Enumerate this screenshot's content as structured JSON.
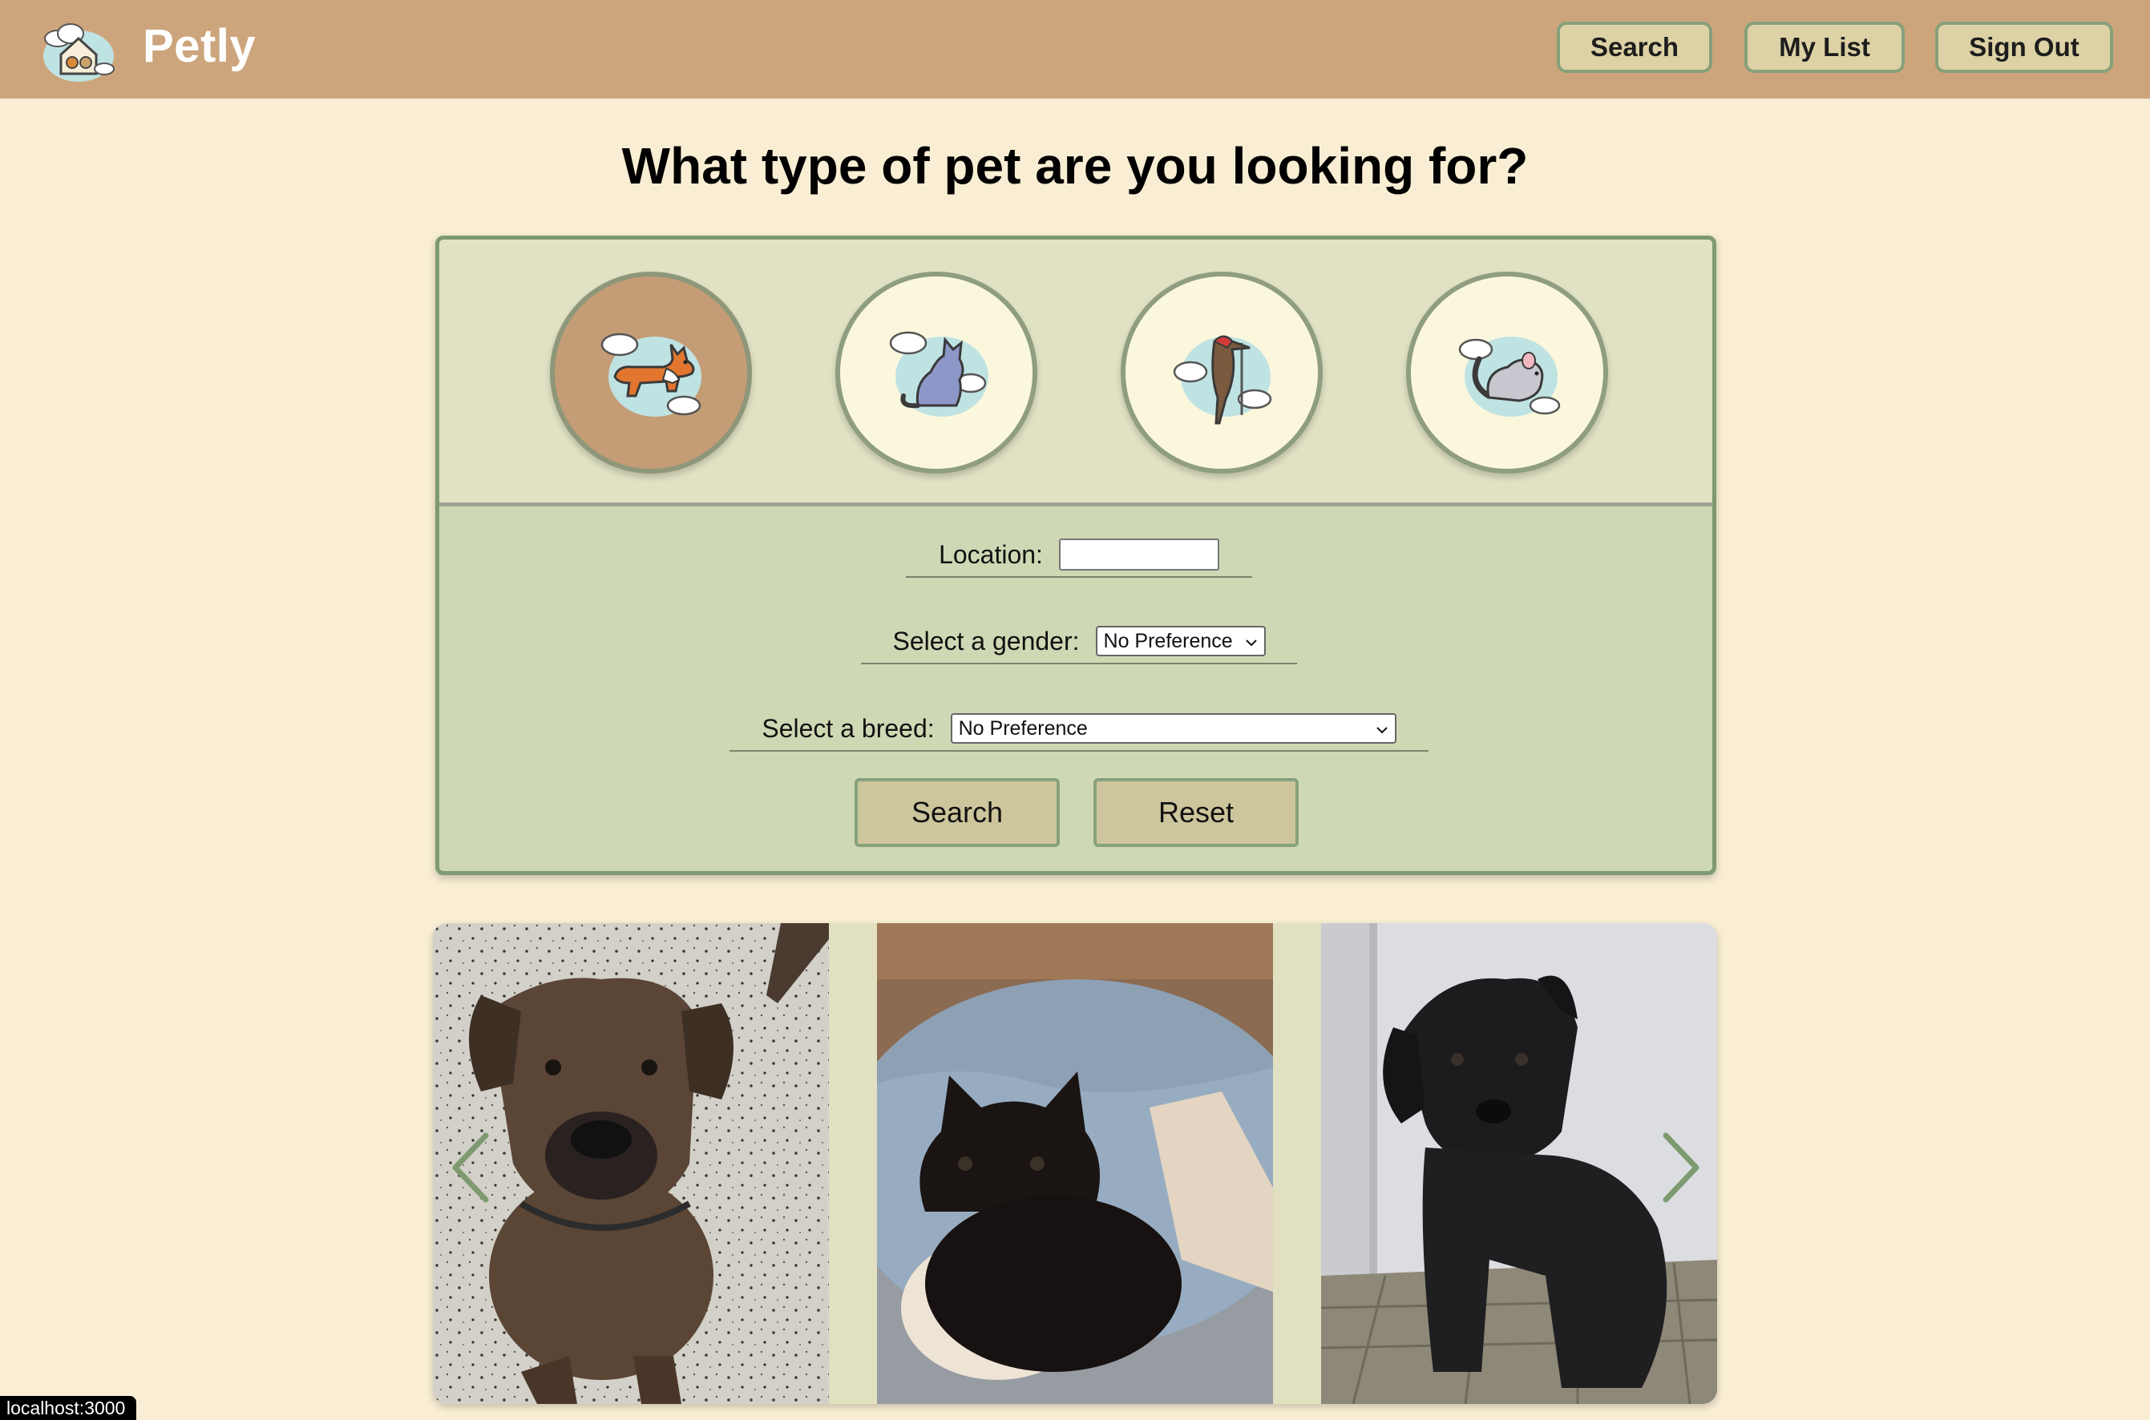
{
  "navbar": {
    "brand": "Petly",
    "buttons": {
      "search": "Search",
      "my_list": "My List",
      "sign_out": "Sign Out"
    }
  },
  "headline": "What type of pet are you looking for?",
  "pet_types": [
    {
      "icon": "dog-icon",
      "selected": true
    },
    {
      "icon": "cat-icon",
      "selected": false
    },
    {
      "icon": "bird-icon",
      "selected": false
    },
    {
      "icon": "small-animal-icon",
      "selected": false
    }
  ],
  "form": {
    "location_label": "Location:",
    "location_value": "",
    "gender_label": "Select a gender:",
    "gender_value": "No Preference",
    "breed_label": "Select a breed:",
    "breed_value": "No Preference",
    "search_button": "Search",
    "reset_button": "Reset"
  },
  "carousel": {
    "photos": [
      "brindle-puppy-photo",
      "black-kitten-photo",
      "black-puppy-photo"
    ],
    "prev_icon": "chevron-left-icon",
    "next_icon": "chevron-right-icon"
  },
  "status_bar": "localhost:3000",
  "colors": {
    "navbar": "#cda57c",
    "page_background": "#f9eed4",
    "panel_top": "#e1e2c3",
    "panel_form": "#cfd8b4",
    "accent_border": "#7d9a70",
    "button_fill": "#cdc59c",
    "selected_pet": "#c49c75"
  }
}
